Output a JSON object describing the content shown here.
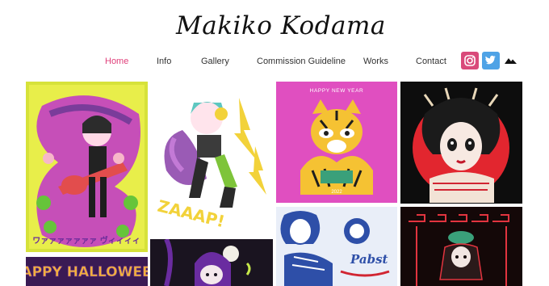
{
  "site": {
    "brand_text": "Makiko Kodama"
  },
  "nav": {
    "items": [
      {
        "label": "Home",
        "active": true
      },
      {
        "label": "Info"
      },
      {
        "label": "Gallery"
      },
      {
        "label": "Commission Guideline"
      },
      {
        "label": "Works"
      },
      {
        "label": "Contact"
      }
    ]
  },
  "social": [
    {
      "icon": "instagram-icon",
      "color": "#d94a7a"
    },
    {
      "icon": "twitter-icon",
      "color": "#4fa3e6"
    },
    {
      "icon": "mountain-icon",
      "color": "#111111"
    }
  ],
  "gallery": {
    "tile1": {
      "text": "ワァァァァァァァ ヴィィィィ"
    },
    "tile2": {
      "text": "ZAAAP!"
    },
    "tile3": {
      "title": "HAPPY NEW YEAR",
      "year": "2022",
      "bg": "#e04fc0"
    },
    "tile4": {
      "bg": "#0d0d0d"
    },
    "tile5": {
      "text": "HAPPY HALLOWEEN"
    },
    "tile6": {
      "bg": "#1a1420"
    },
    "tile7": {
      "text": "Pabst",
      "bg": "#e9eef8"
    },
    "tile8": {
      "bg": "#140808"
    }
  }
}
